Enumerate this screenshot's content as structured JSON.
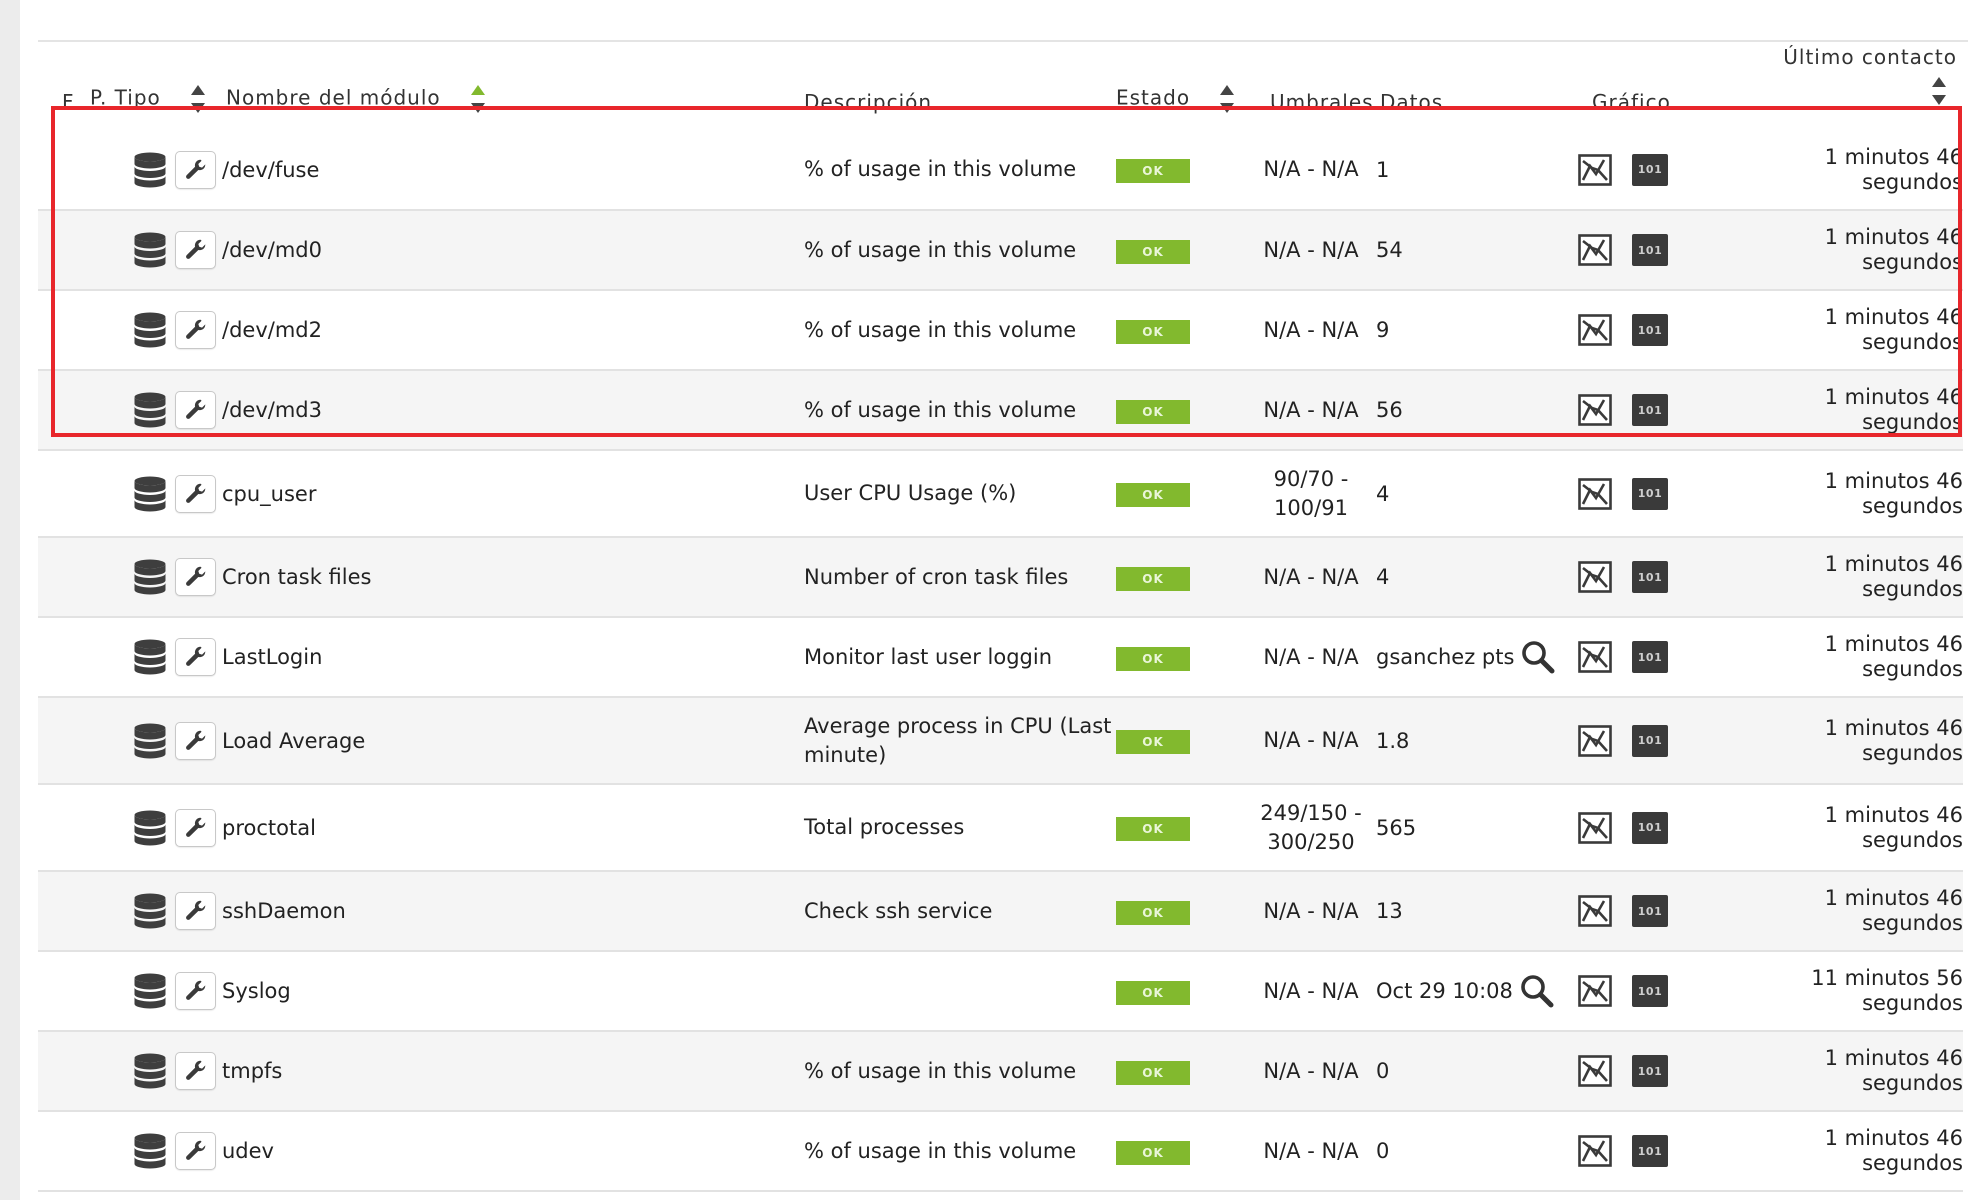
{
  "header": {
    "f": "F.",
    "p": "P.",
    "tipo": "Tipo",
    "nombre": "Nombre del módulo",
    "descripcion": "Descripción",
    "estado": "Estado",
    "umbrales": "Umbrales",
    "datos": "Datos",
    "grafico": "Gráfico",
    "ultimo": "Último contacto"
  },
  "colors": {
    "ok_green": "#82b92e",
    "highlight_red": "#e8262b",
    "sort_active_green": "#82b92e"
  },
  "raw_label": "101",
  "rows": [
    {
      "name": "/dev/fuse",
      "desc": "% of usage in this volume",
      "status": "OK",
      "thr": "N/A - N/A",
      "data": "1",
      "contact_1": "1 minutos 46",
      "contact_2": "segundos"
    },
    {
      "name": "/dev/md0",
      "desc": "% of usage in this volume",
      "status": "OK",
      "thr": "N/A - N/A",
      "data": "54",
      "contact_1": "1 minutos 46",
      "contact_2": "segundos"
    },
    {
      "name": "/dev/md2",
      "desc": "% of usage in this volume",
      "status": "OK",
      "thr": "N/A - N/A",
      "data": "9",
      "contact_1": "1 minutos 46",
      "contact_2": "segundos"
    },
    {
      "name": "/dev/md3",
      "desc": "% of usage in this volume",
      "status": "OK",
      "thr": "N/A - N/A",
      "data": "56",
      "contact_1": "1 minutos 46",
      "contact_2": "segundos"
    },
    {
      "name": "cpu_user",
      "desc": "User CPU Usage (%)",
      "status": "OK",
      "thr_1": "90/70 -",
      "thr_2": "100/91",
      "data": "4",
      "contact_1": "1 minutos 46",
      "contact_2": "segundos"
    },
    {
      "name": "Cron task files",
      "desc": "Number of cron task files",
      "status": "OK",
      "thr": "N/A - N/A",
      "data": "4",
      "contact_1": "1 minutos 46",
      "contact_2": "segundos"
    },
    {
      "name": "LastLogin",
      "desc": "Monitor last user loggin",
      "status": "OK",
      "thr": "N/A - N/A",
      "data": "gsanchez pts",
      "contact_1": "1 minutos 46",
      "contact_2": "segundos"
    },
    {
      "name": "Load Average",
      "desc_1": "Average process in CPU (Last",
      "desc_2": "minute)",
      "status": "OK",
      "thr": "N/A - N/A",
      "data": "1.8",
      "contact_1": "1 minutos 46",
      "contact_2": "segundos"
    },
    {
      "name": "proctotal",
      "desc": "Total processes",
      "status": "OK",
      "thr_1": "249/150 -",
      "thr_2": "300/250",
      "data": "565",
      "contact_1": "1 minutos 46",
      "contact_2": "segundos"
    },
    {
      "name": "sshDaemon",
      "desc": "Check ssh service",
      "status": "OK",
      "thr": "N/A - N/A",
      "data": "13",
      "contact_1": "1 minutos 46",
      "contact_2": "segundos"
    },
    {
      "name": "Syslog",
      "desc": "",
      "status": "OK",
      "thr": "N/A - N/A",
      "data": "Oct 29 10:08",
      "contact_1": "11 minutos 56",
      "contact_2": "segundos"
    },
    {
      "name": "tmpfs",
      "desc": "% of usage in this volume",
      "status": "OK",
      "thr": "N/A - N/A",
      "data": "0",
      "contact_1": "1 minutos 46",
      "contact_2": "segundos"
    },
    {
      "name": "udev",
      "desc": "% of usage in this volume",
      "status": "OK",
      "thr": "N/A - N/A",
      "data": "0",
      "contact_1": "1 minutos 46",
      "contact_2": "segundos"
    }
  ]
}
